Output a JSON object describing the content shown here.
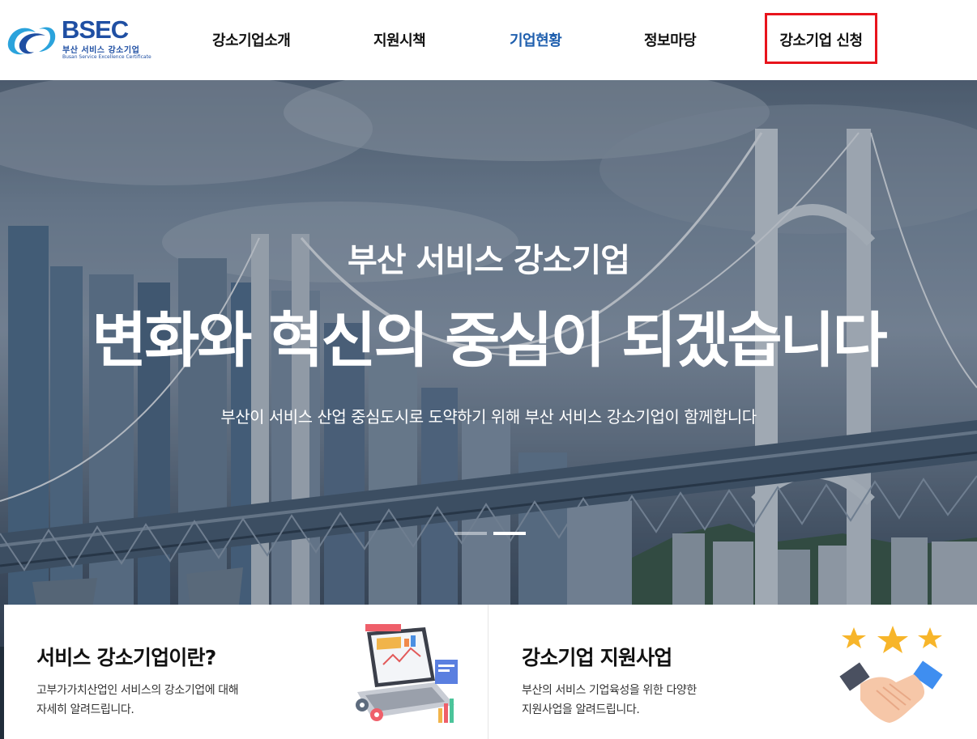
{
  "logo": {
    "brand": "BSEC",
    "subtitle": "부산 서비스 강소기업",
    "tagline": "Busan Service Excellence Certificate"
  },
  "nav": {
    "items": [
      {
        "label": "강소기업소개",
        "active": false
      },
      {
        "label": "지원시책",
        "active": false
      },
      {
        "label": "기업현황",
        "active": true
      },
      {
        "label": "정보마당",
        "active": false
      }
    ],
    "cta_label": "강소기업 신청"
  },
  "hero": {
    "kicker": "부산 서비스 강소기업",
    "title": "변화와 혁신의 중심이 되겠습니다",
    "description": "부산이 서비스 산업 중심도시로 도약하기 위해 부산 서비스 강소기업이 함께합니다",
    "slides_total": 2,
    "active_slide": 2
  },
  "cards": [
    {
      "title": "서비스 강소기업이란?",
      "desc_line1": "고부가가치산업인 서비스의 강소기업에 대해",
      "desc_line2": "자세히 알려드립니다.",
      "icon": "laptop-analytics-icon"
    },
    {
      "title": "강소기업 지원사업",
      "desc_line1": "부산의 서비스 기업육성을 위한 다양한",
      "desc_line2": "지원사업을 알려드립니다.",
      "icon": "handshake-stars-icon"
    }
  ],
  "colors": {
    "brand": "#1f4fa3",
    "active_nav": "#1f5fae",
    "cta_border": "#e8141c",
    "text": "#111111"
  }
}
